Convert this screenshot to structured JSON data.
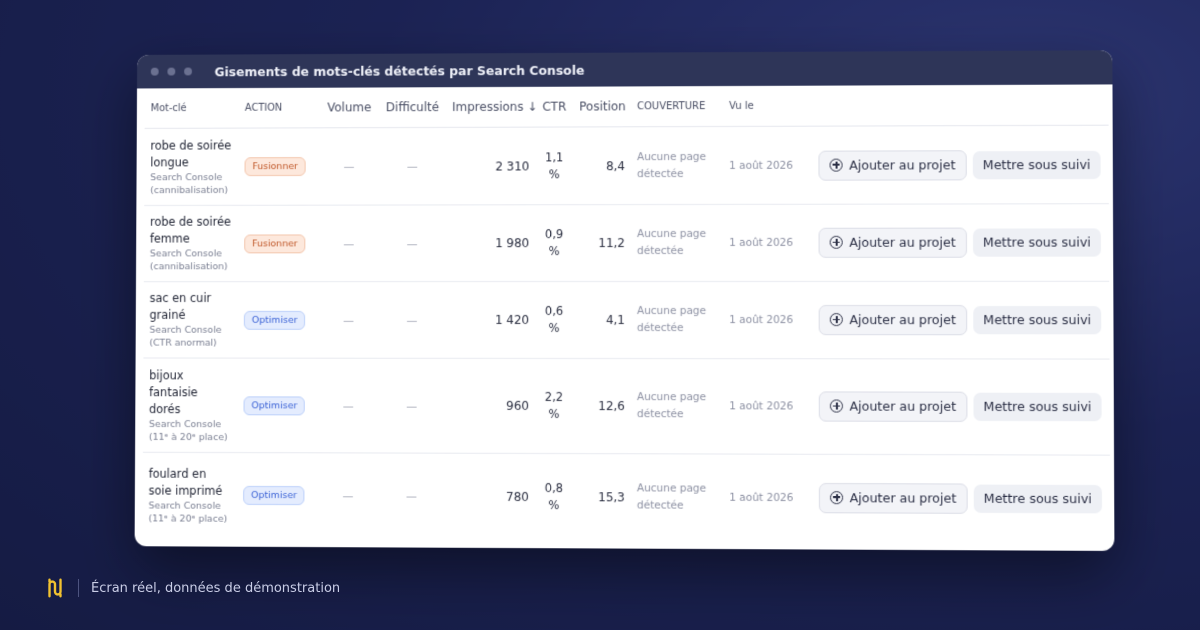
{
  "window": {
    "title": "Gisements de mots-clés détectés par Search Console"
  },
  "columns": [
    "Mot-clé",
    "ACTION",
    "Volume",
    "Difficulté",
    "Impressions ↓",
    "CTR",
    "Position",
    "COUVERTURE",
    "Vu le"
  ],
  "rows": [
    {
      "keyword": "robe de soirée longue",
      "source": "Search Console",
      "source_detail": "(cannibalisation)",
      "action": "Fusionner",
      "volume": "—",
      "difficulty": "—",
      "impressions": "2 310",
      "ctr": "1,1",
      "ctr_unit": "%",
      "position": "8,4",
      "coverage": "Aucune page détectée",
      "seen": "1 août 2026"
    },
    {
      "keyword": "robe de soirée femme",
      "source": "Search Console",
      "source_detail": "(cannibalisation)",
      "action": "Fusionner",
      "volume": "—",
      "difficulty": "—",
      "impressions": "1 980",
      "ctr": "0,9",
      "ctr_unit": "%",
      "position": "11,2",
      "coverage": "Aucune page détectée",
      "seen": "1 août 2026"
    },
    {
      "keyword": "sac en cuir grainé",
      "source": "Search Console",
      "source_detail": "(CTR anormal)",
      "action": "Optimiser",
      "volume": "—",
      "difficulty": "—",
      "impressions": "1 420",
      "ctr": "0,6",
      "ctr_unit": "%",
      "position": "4,1",
      "coverage": "Aucune page détectée",
      "seen": "1 août 2026"
    },
    {
      "keyword": "bijoux fantaisie dorés",
      "source": "Search Console",
      "source_detail": "(11ᵉ à 20ᵉ place)",
      "action": "Optimiser",
      "volume": "—",
      "difficulty": "—",
      "impressions": "960",
      "ctr": "2,2",
      "ctr_unit": "%",
      "position": "12,6",
      "coverage": "Aucune page détectée",
      "seen": "1 août 2026"
    },
    {
      "keyword": "foulard en soie imprimé",
      "source": "Search Console",
      "source_detail": "(11ᵉ à 20ᵉ place)",
      "action": "Optimiser",
      "volume": "—",
      "difficulty": "—",
      "impressions": "780",
      "ctr": "0,8",
      "ctr_unit": "%",
      "position": "15,3",
      "coverage": "Aucune page détectée",
      "seen": "1 août 2026"
    }
  ],
  "buttons": {
    "add": "Ajouter au projet",
    "follow": "Mettre sous suivi"
  },
  "footer": {
    "text": "Écran réel, données de démonstration"
  },
  "colors": {
    "background": "#1b2253",
    "titlebar": "#2e3558",
    "fusionner": "#c0582a",
    "optimiser": "#3c63d6",
    "logo": "#f2c230"
  }
}
